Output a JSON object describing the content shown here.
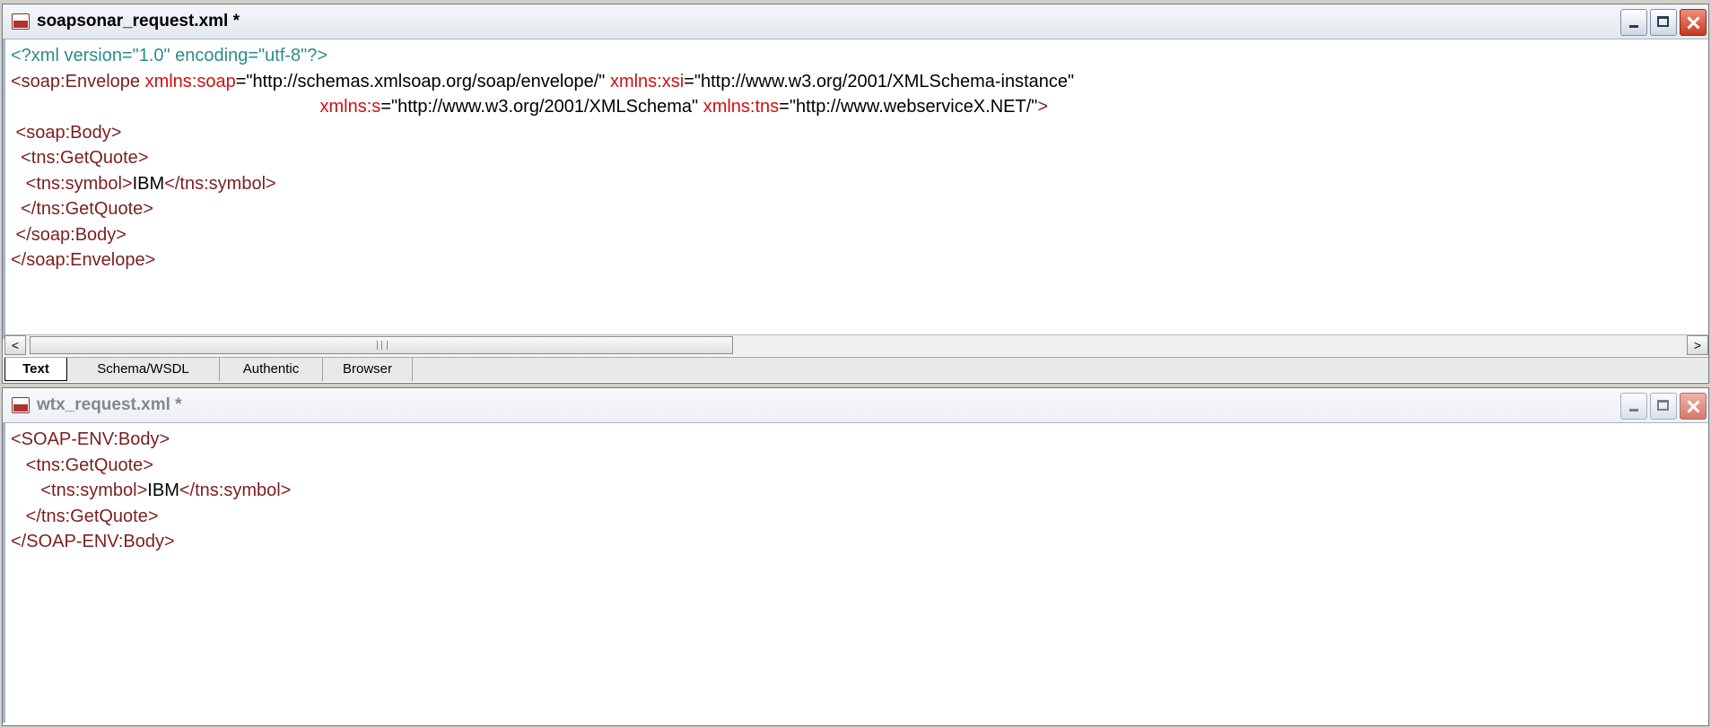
{
  "window1": {
    "title": "soapsonar_request.xml *",
    "lines": [
      [
        {
          "t": "pi",
          "v": "<?xml version=\"1.0\" encoding=\"utf-8\"?>"
        }
      ],
      [
        {
          "t": "tag",
          "v": "<soap:Envelope "
        },
        {
          "t": "attr",
          "v": "xmlns:soap"
        },
        {
          "t": "eq",
          "v": "="
        },
        {
          "t": "val",
          "v": "\"http://schemas.xmlsoap.org/soap/envelope/\" "
        },
        {
          "t": "attr",
          "v": "xmlns:xsi"
        },
        {
          "t": "eq",
          "v": "="
        },
        {
          "t": "val",
          "v": "\"http://www.w3.org/2001/XMLSchema-instance\""
        }
      ],
      [
        {
          "t": "val",
          "v": "                                                              "
        },
        {
          "t": "attr",
          "v": "xmlns:s"
        },
        {
          "t": "eq",
          "v": "="
        },
        {
          "t": "val",
          "v": "\"http://www.w3.org/2001/XMLSchema\" "
        },
        {
          "t": "attr",
          "v": "xmlns:tns"
        },
        {
          "t": "eq",
          "v": "="
        },
        {
          "t": "val",
          "v": "\"http://www.webserviceX.NET/\""
        },
        {
          "t": "tag",
          "v": ">"
        }
      ],
      [
        {
          "t": "tag",
          "v": " <soap:Body>"
        }
      ],
      [
        {
          "t": "tag",
          "v": "  <tns:GetQuote>"
        }
      ],
      [
        {
          "t": "tag",
          "v": "   <tns:symbol>"
        },
        {
          "t": "val",
          "v": "IBM"
        },
        {
          "t": "tag",
          "v": "</tns:symbol>"
        }
      ],
      [
        {
          "t": "tag",
          "v": "  </tns:GetQuote>"
        }
      ],
      [
        {
          "t": "tag",
          "v": " </soap:Body>"
        }
      ],
      [
        {
          "t": "tag",
          "v": "</soap:Envelope>"
        }
      ]
    ],
    "scroll_left": "<",
    "scroll_right": ">",
    "tabs": [
      "Text",
      "Schema/WSDL",
      "Authentic",
      "Browser"
    ]
  },
  "window2": {
    "title": "wtx_request.xml *",
    "lines": [
      [
        {
          "t": "tag",
          "v": "<SOAP-ENV:Body>"
        }
      ],
      [
        {
          "t": "tag",
          "v": "   <tns:GetQuote>"
        }
      ],
      [
        {
          "t": "tag",
          "v": "      <tns:symbol>"
        },
        {
          "t": "val",
          "v": "IBM"
        },
        {
          "t": "tag",
          "v": "</tns:symbol>"
        }
      ],
      [
        {
          "t": "tag",
          "v": "   </tns:GetQuote>"
        }
      ],
      [
        {
          "t": "tag",
          "v": "</SOAP-ENV:Body>"
        }
      ]
    ]
  },
  "colors": {
    "processing_instruction": "#2e8b8b",
    "tag": "#7a1f1f",
    "attribute": "#d01010",
    "value": "#000000"
  },
  "icons": [
    "xml-file-icon",
    "minimize-icon",
    "maximize-icon",
    "close-icon",
    "scroll-left-icon",
    "scroll-right-icon"
  ]
}
